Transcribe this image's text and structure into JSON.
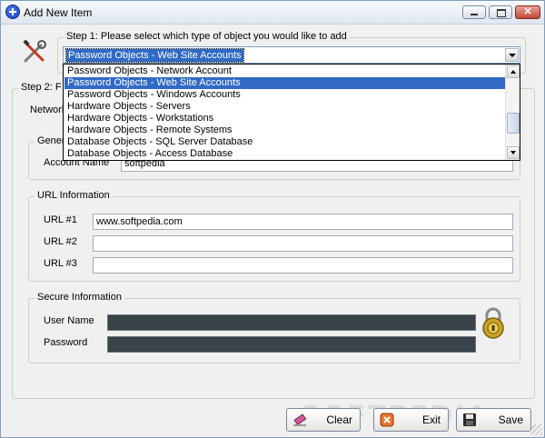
{
  "window": {
    "title": "Add New Item",
    "close_glyph": "✕"
  },
  "step1": {
    "legend": "Step 1: Please select which type of object you would like to add",
    "selected_value": "Password Objects - Web Site Accounts",
    "options": [
      "Password Objects - Network Account",
      "Password Objects - Web Site Accounts",
      "Password Objects - Windows Accounts",
      "Hardware Objects - Servers",
      "Hardware Objects - Workstations",
      "Hardware Objects - Remote Systems",
      "Database Objects - SQL Server Database",
      "Database Objects - Access Database"
    ],
    "highlighted_index": 1
  },
  "step2": {
    "legend_partial": "Step 2: F",
    "network_label_partial": "Network",
    "general_legend_partial": "Gener",
    "account_name_label": "Account Name",
    "account_name_value": "softpedia"
  },
  "url_info": {
    "legend": "URL Information",
    "url1_label": "URL #1",
    "url1_value": "www.softpedia.com",
    "url2_label": "URL #2",
    "url2_value": "",
    "url3_label": "URL #3",
    "url3_value": ""
  },
  "secure_info": {
    "legend": "Secure Information",
    "user_name_label": "User Name",
    "password_label": "Password"
  },
  "buttons": {
    "clear": "Clear",
    "exit": "Exit",
    "save": "Save"
  },
  "watermark": "SOFTPEDIA",
  "icons": {
    "title": "add-circle-icon",
    "tools": "tools-icon",
    "lock": "padlock-icon",
    "clear": "eraser-icon",
    "exit": "exit-icon",
    "save": "floppy-disk-icon"
  },
  "colors": {
    "selection": "#316ac5",
    "secure_field": "#3a4347"
  }
}
